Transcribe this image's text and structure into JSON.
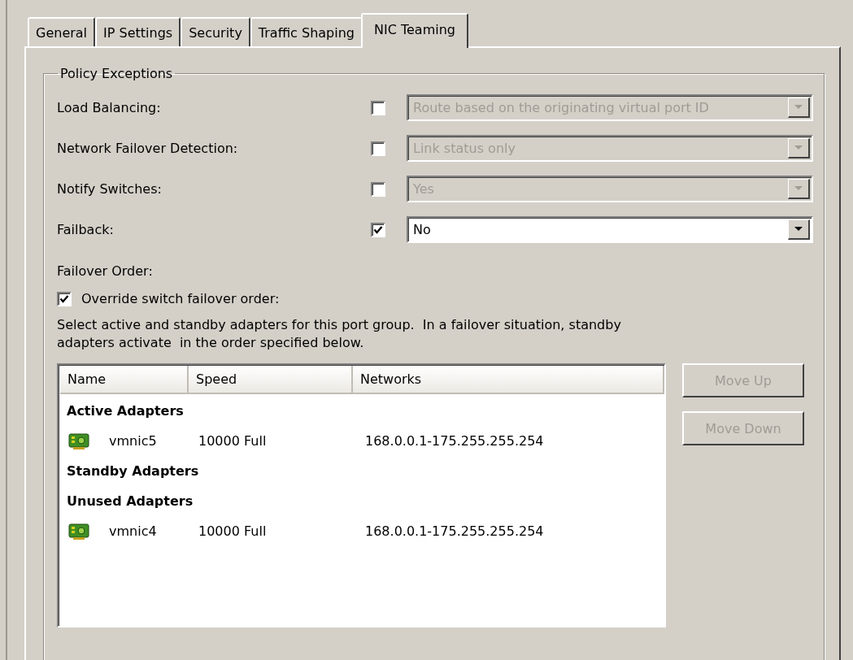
{
  "tabs": [
    {
      "label": "General",
      "selected": false
    },
    {
      "label": "IP Settings",
      "selected": false
    },
    {
      "label": "Security",
      "selected": false
    },
    {
      "label": "Traffic Shaping",
      "selected": false
    },
    {
      "label": "NIC Teaming",
      "selected": true
    }
  ],
  "policy_exceptions": {
    "title": "Policy Exceptions",
    "rows": [
      {
        "label": "Load Balancing:",
        "checked": false,
        "value": "Route based on the originating virtual port ID",
        "disabled": true
      },
      {
        "label": "Network Failover Detection:",
        "checked": false,
        "value": "Link status only",
        "disabled": true
      },
      {
        "label": "Notify Switches:",
        "checked": false,
        "value": "Yes",
        "disabled": true
      },
      {
        "label": "Failback:",
        "checked": true,
        "value": "No",
        "disabled": false
      }
    ]
  },
  "failover_order": {
    "label": "Failover Order:",
    "override": {
      "label": "Override switch failover order:",
      "checked": true
    },
    "description_lines": [
      "Select active and standby adapters for this port group.  In a failover situation, standby",
      "adapters activate  in the order specified below."
    ],
    "columns": [
      "Name",
      "Speed",
      "Networks"
    ],
    "groups": [
      {
        "title": "Active Adapters",
        "adapters": [
          {
            "name": "vmnic5",
            "speed": "10000 Full",
            "networks": "168.0.0.1-175.255.255.254"
          }
        ]
      },
      {
        "title": "Standby Adapters"
      },
      {
        "title": "Unused Adapters",
        "adapters": [
          {
            "name": "vmnic4",
            "speed": "10000 Full",
            "networks": "168.0.0.1-175.255.255.254"
          }
        ]
      }
    ],
    "buttons": [
      {
        "label": "Move Up",
        "disabled": true
      },
      {
        "label": "Move Down",
        "disabled": true
      }
    ]
  }
}
